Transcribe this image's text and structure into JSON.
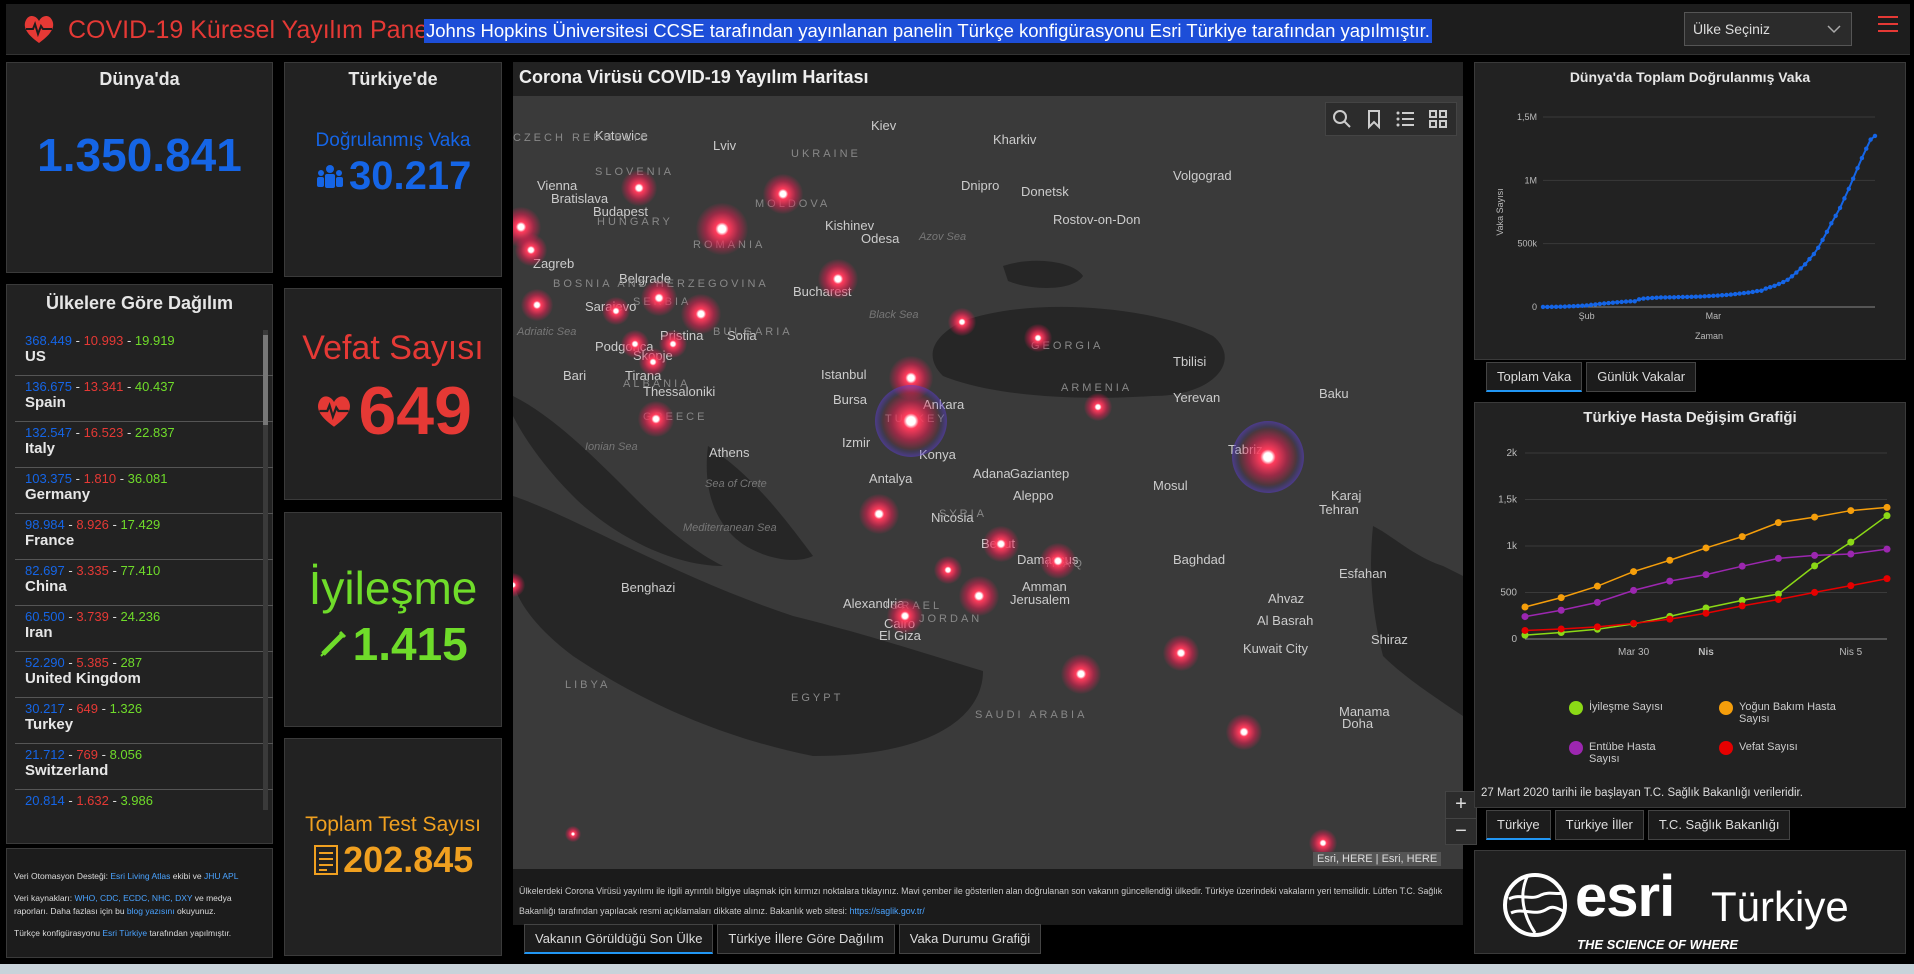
{
  "header": {
    "title": "COVID-19 Küresel Yayılım Paneli",
    "attribution": "Johns Hopkins Üniversitesi CCSE tarafından yayınlanan panelin Türkçe konfigürasyonu Esri Türkiye tarafından yapılmıştır.",
    "country_select_value": "Ülke Seçiniz",
    "accent": "#e53935"
  },
  "world": {
    "title": "Dünya'da",
    "total": "1.350.841"
  },
  "turkey": {
    "title": "Türkiye'de",
    "confirmed_label": "Doğrulanmış Vaka",
    "confirmed": "30.217",
    "deaths_label": "Vefat Sayısı",
    "deaths": "649",
    "recovered_label": "İyileşme",
    "recovered": "1.415",
    "tests_label": "Toplam Test Sayısı",
    "tests": "202.845"
  },
  "countries": {
    "title": "Ülkelere Göre Dağılım",
    "rows": [
      {
        "confirmed": "368.449",
        "deaths": "10.993",
        "recovered": "19.919",
        "name": "US"
      },
      {
        "confirmed": "136.675",
        "deaths": "13.341",
        "recovered": "40.437",
        "name": "Spain"
      },
      {
        "confirmed": "132.547",
        "deaths": "16.523",
        "recovered": "22.837",
        "name": "Italy"
      },
      {
        "confirmed": "103.375",
        "deaths": "1.810",
        "recovered": "36.081",
        "name": "Germany"
      },
      {
        "confirmed": "98.984",
        "deaths": "8.926",
        "recovered": "17.429",
        "name": "France"
      },
      {
        "confirmed": "82.697",
        "deaths": "3.335",
        "recovered": "77.410",
        "name": "China"
      },
      {
        "confirmed": "60.500",
        "deaths": "3.739",
        "recovered": "24.236",
        "name": "Iran"
      },
      {
        "confirmed": "52.290",
        "deaths": "5.385",
        "recovered": "287",
        "name": "United Kingdom"
      },
      {
        "confirmed": "30.217",
        "deaths": "649",
        "recovered": "1.326",
        "name": "Turkey"
      },
      {
        "confirmed": "21.712",
        "deaths": "769",
        "recovered": "8.056",
        "name": "Switzerland"
      },
      {
        "confirmed": "20.814",
        "deaths": "1.632",
        "recovered": "3.986",
        "name": ""
      }
    ]
  },
  "notes": {
    "line1_pre": "Veri Otomasyon Desteği: ",
    "line1_link1": "Esri Living Atlas",
    "line1_mid": " ekibi ve ",
    "line1_link2": "JHU APL",
    "line2_pre": "Veri kaynakları: ",
    "line2_links": "WHO, CDC, ECDC, NHC, DXY",
    "line2_post": " ve medya raporları. Daha fazlası için bu ",
    "line2_link3": "blog yazısını",
    "line2_end": " okuyunuz.",
    "line3_pre": "Türkçe konfigürasyonu ",
    "line3_link": "Esri Türkiye",
    "line3_post": " tarafından yapılmıştır."
  },
  "map": {
    "title": "Corona Virüsü COVID-19 Yayılım Haritası",
    "credit": "Esri, HERE | Esri, HERE",
    "zoom_in": "+",
    "zoom_out": "−",
    "description": "Ülkelerdeki Corona Virüsü yayılımı ile ilgili ayrıntılı bilgiye ulaşmak için kırmızı noktalara tıklayınız. Mavi çember ile gösterilen alan doğrulanan son vakanın güncellendiği ülkedir. Türkiye üzerindeki vakaların yeri temsilidir. Lütfen T.C. Sağlık Bakanlığı tarafından yapılacak resmi açıklamaları dikkate alınız. Bakanlık web sitesi: ",
    "desc_link": "https://saglik.gov.tr/",
    "labels": [
      "Katowice",
      "Lviv",
      "Kiev",
      "Kharkiv",
      "Volgograd",
      "Vienna",
      "Bratislava",
      "Budapest",
      "Kishinev",
      "Dnipro",
      "Donetsk",
      "Rostov-on-Don",
      "Zagreb",
      "Odesa",
      "Belgrade",
      "Bucharest",
      "Sarajevo",
      "Pristina",
      "Sofia",
      "Podgorica",
      "Skopje",
      "Bari",
      "Tirana",
      "Istanbul",
      "Tbilisi",
      "Thessaloniki",
      "Bursa",
      "Ankara",
      "Yerevan",
      "Baku",
      "Athens",
      "Izmir",
      "Konya",
      "Tabriz",
      "Antalya",
      "Adana",
      "Gaziantep",
      "Aleppo",
      "Mosul",
      "Karaj",
      "Tehran",
      "Nicosia",
      "Beirut",
      "Damascus",
      "Baghdad",
      "Esfahan",
      "Benghazi",
      "Amman",
      "Jerusalem",
      "Alexandria",
      "Ahvaz",
      "Cairo",
      "El Giza",
      "Al Basrah",
      "Kuwait City",
      "Shiraz",
      "Manama",
      "Doha"
    ],
    "countries": [
      "UKRAINE",
      "TURKEY",
      "LIBYA",
      "EGYPT",
      "SAUDI ARABIA",
      "IRAQ",
      "SYRIA",
      "JORDAN",
      "ISRAEL",
      "GEORGIA",
      "ARMENIA",
      "ROMANIA",
      "BULGARIA",
      "SERBIA",
      "HUNGARY",
      "SLOVENIA",
      "CZECH REPUBLIC",
      "MOLDOVA",
      "GREECE",
      "ALBANIA",
      "BOSNIA AND HERZEGOVINA"
    ],
    "seas": [
      "Black Sea",
      "Azov Sea",
      "Adriatic Sea",
      "Ionian Sea",
      "Sea of Crete",
      "Mediterranean Sea"
    ]
  },
  "map_tabs": [
    "Vakanın Görüldüğü Son Ülke",
    "Türkiye İllere Göre Dağılım",
    "Vaka Durumu Grafiği"
  ],
  "world_chart": {
    "title": "Dünya'da Toplam Doğrulanmış Vaka",
    "tabs": [
      "Toplam Vaka",
      "Günlük Vakalar"
    ],
    "chart_data": {
      "type": "line",
      "title": "Dünya'da Toplam Doğrulanmış Vaka",
      "xlabel": "Zaman",
      "ylabel": "Vaka Sayısı",
      "x_ticks": [
        "Şub",
        "Mar"
      ],
      "y_ticks": [
        "0",
        "500k",
        "1M",
        "1,5M"
      ],
      "ylim": [
        0,
        1500000
      ],
      "series": [
        {
          "name": "",
          "color": "#1565e6",
          "values": [
            555,
            654,
            941,
            1434,
            2118,
            2927,
            5578,
            6166,
            8234,
            9927,
            12038,
            16787,
            19881,
            23892,
            27635,
            30794,
            34391,
            37120,
            40150,
            42762,
            44802,
            45221,
            60368,
            66885,
            69030,
            71224,
            73258,
            75136,
            75639,
            76197,
            76819,
            78572,
            78958,
            79561,
            80406,
            81388,
            82746,
            84112,
            86011,
            88369,
            90306,
            92840,
            95120,
            97886,
            101801,
            105847,
            109821,
            113590,
            118620,
            125875,
            128352,
            145205,
            156101,
            167454,
            181574,
            197102,
            214821,
            242570,
            272208,
            304507,
            336953,
            378235,
            418045,
            467653,
            529591,
            593291,
            660706,
            720117,
            782365,
            857487,
            932605,
            1013157,
            1095917,
            1176060,
            1249754,
            1321481,
            1350841
          ]
        }
      ]
    }
  },
  "turkey_chart": {
    "title": "Türkiye Hasta Değişim Grafiği",
    "note": "27 Mart 2020 tarihi ile başlayan T.C. Sağlık Bakanlığı verileridir.",
    "tabs": [
      "Türkiye",
      "Türkiye İller",
      "T.C. Sağlık Bakanlığı"
    ],
    "chart_data": {
      "type": "line",
      "title": "Türkiye Hasta Değişim Grafiği",
      "x_ticks": [
        "Mar 30",
        "Nis",
        "Nis 5"
      ],
      "y_ticks": [
        "0",
        "500",
        "1k",
        "1,5k",
        "2k"
      ],
      "ylim": [
        0,
        2000
      ],
      "categories": [
        "Mar 27",
        "Mar 28",
        "Mar 29",
        "Mar 30",
        "Mar 31",
        "Nis 1",
        "Nis 2",
        "Nis 3",
        "Nis 4",
        "Nis 5",
        "Nis 6"
      ],
      "series": [
        {
          "name": "İyileşme Sayısı",
          "color": "#8bd916",
          "values": [
            42,
            70,
            105,
            162,
            243,
            333,
            415,
            484,
            786,
            1042,
            1326
          ]
        },
        {
          "name": "Yoğun Bakım Hasta Sayısı",
          "color": "#f59e0b",
          "values": [
            344,
            445,
            568,
            725,
            847,
            979,
            1101,
            1251,
            1311,
            1381,
            1415
          ]
        },
        {
          "name": "Entübe Hasta Sayısı",
          "color": "#9c27b0",
          "values": [
            241,
            309,
            394,
            523,
            622,
            692,
            783,
            867,
            899,
            914,
            966
          ]
        },
        {
          "name": "Vefat Sayısı",
          "color": "#e60000",
          "values": [
            92,
            108,
            131,
            168,
            214,
            277,
            356,
            425,
            501,
            574,
            649
          ]
        }
      ]
    }
  },
  "brand": {
    "name": "esri",
    "suffix": "Türkiye",
    "tagline": "THE SCIENCE OF WHERE"
  }
}
